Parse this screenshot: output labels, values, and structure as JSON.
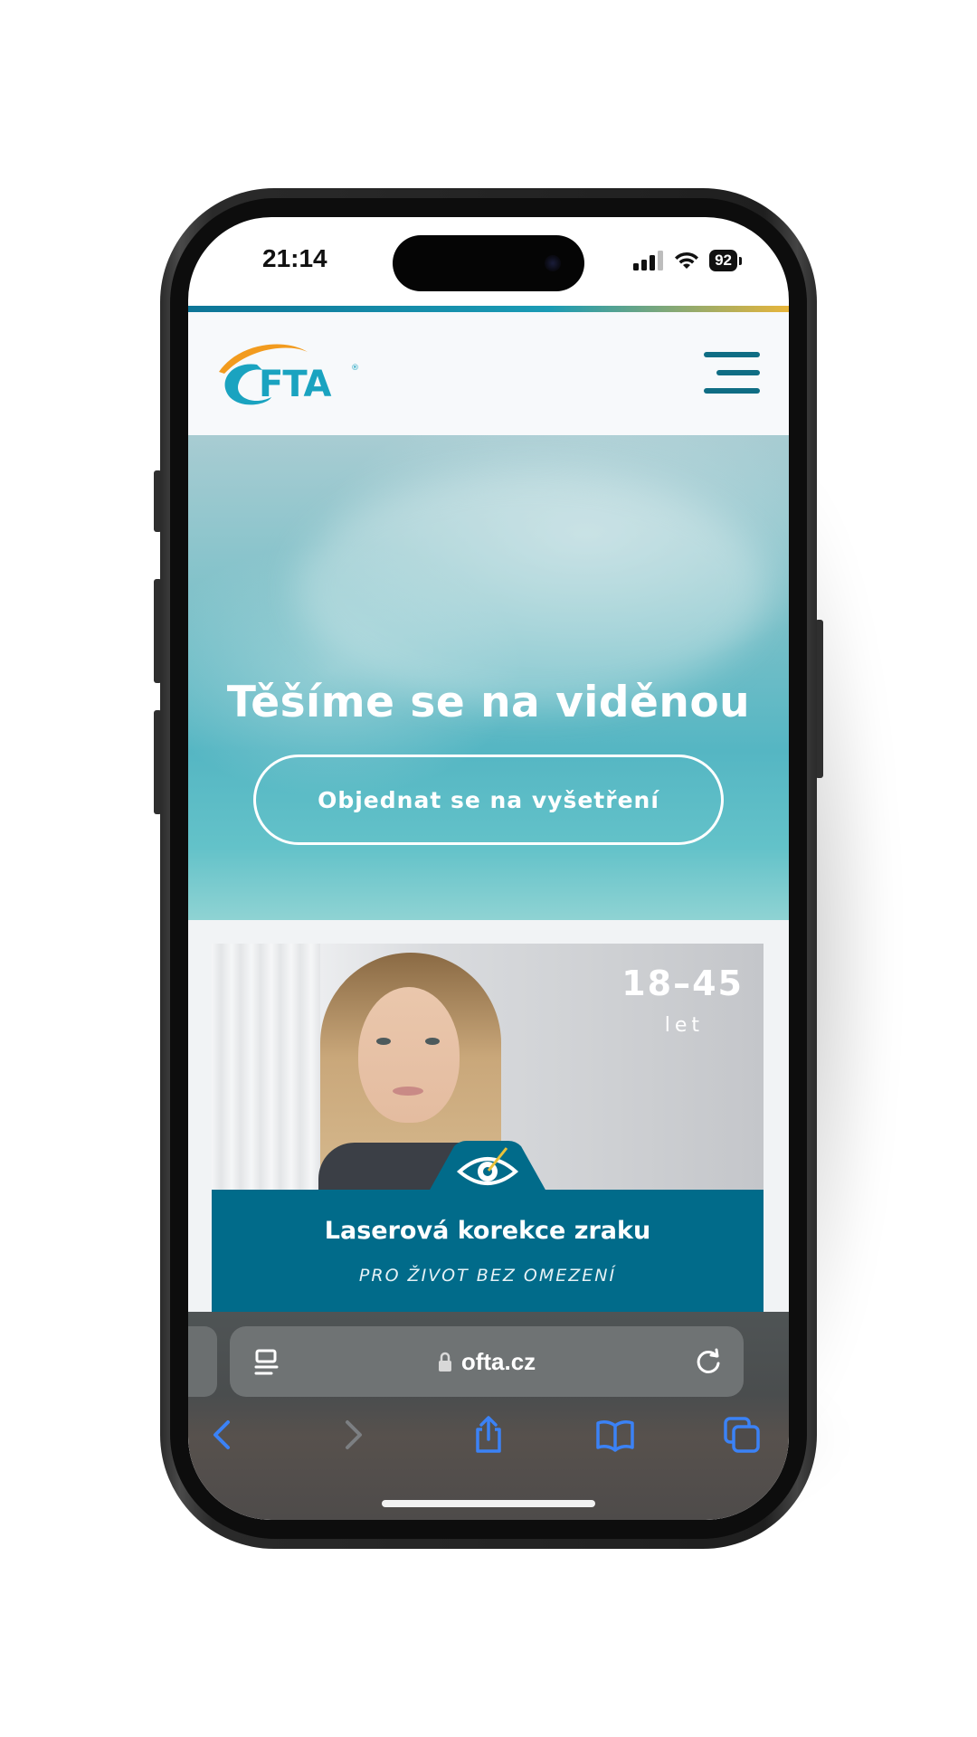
{
  "status_bar": {
    "time": "21:14",
    "battery": "92"
  },
  "site": {
    "logo_text": "OFTA",
    "hero": {
      "title": "Těšíme se na viděnou",
      "cta_label": "Objednat se na vyšetření"
    },
    "card": {
      "age_range": "18–45",
      "age_unit": "let",
      "title": "Laserová korekce zraku",
      "subtitle": "PRO ŽIVOT BEZ OMEZENÍ"
    }
  },
  "browser": {
    "url": "ofta.cz"
  },
  "colors": {
    "brand_teal": "#016b8a",
    "logo_teal": "#1aa3c0",
    "logo_orange": "#f29b1e",
    "browser_blue": "#3b82f6"
  }
}
